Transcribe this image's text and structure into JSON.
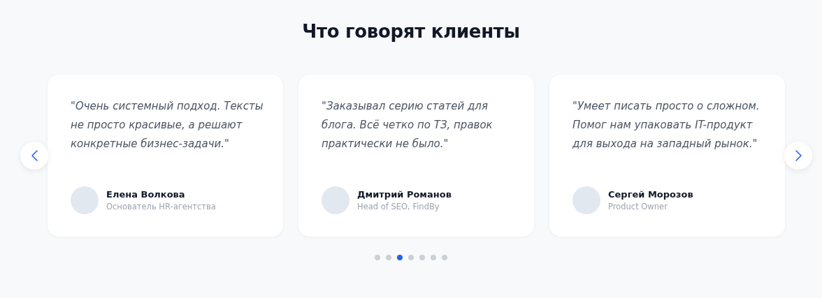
{
  "title": "Что говорят клиенты",
  "testimonials": [
    {
      "quote": "\"Очень системный подход. Тексты не просто красивые, а решают конкретные бизнес-задачи.\"",
      "name": "Елена Волкова",
      "role": "Основатель HR-агентства"
    },
    {
      "quote": "\"Заказывал серию статей для блога. Всё четко по ТЗ, правок практически не было.\"",
      "name": "Дмитрий Романов",
      "role": "Head of SEO, FindBy"
    },
    {
      "quote": "\"Умеет писать просто о сложном. Помог нам упаковать IT-продукт для выхода на западный рынок.\"",
      "name": "Сергей Морозов",
      "role": "Product Owner"
    }
  ],
  "pagination": [
    {
      "selected": false
    },
    {
      "selected": false
    },
    {
      "selected": true
    },
    {
      "selected": false
    },
    {
      "selected": false
    },
    {
      "selected": false
    },
    {
      "selected": false
    }
  ]
}
